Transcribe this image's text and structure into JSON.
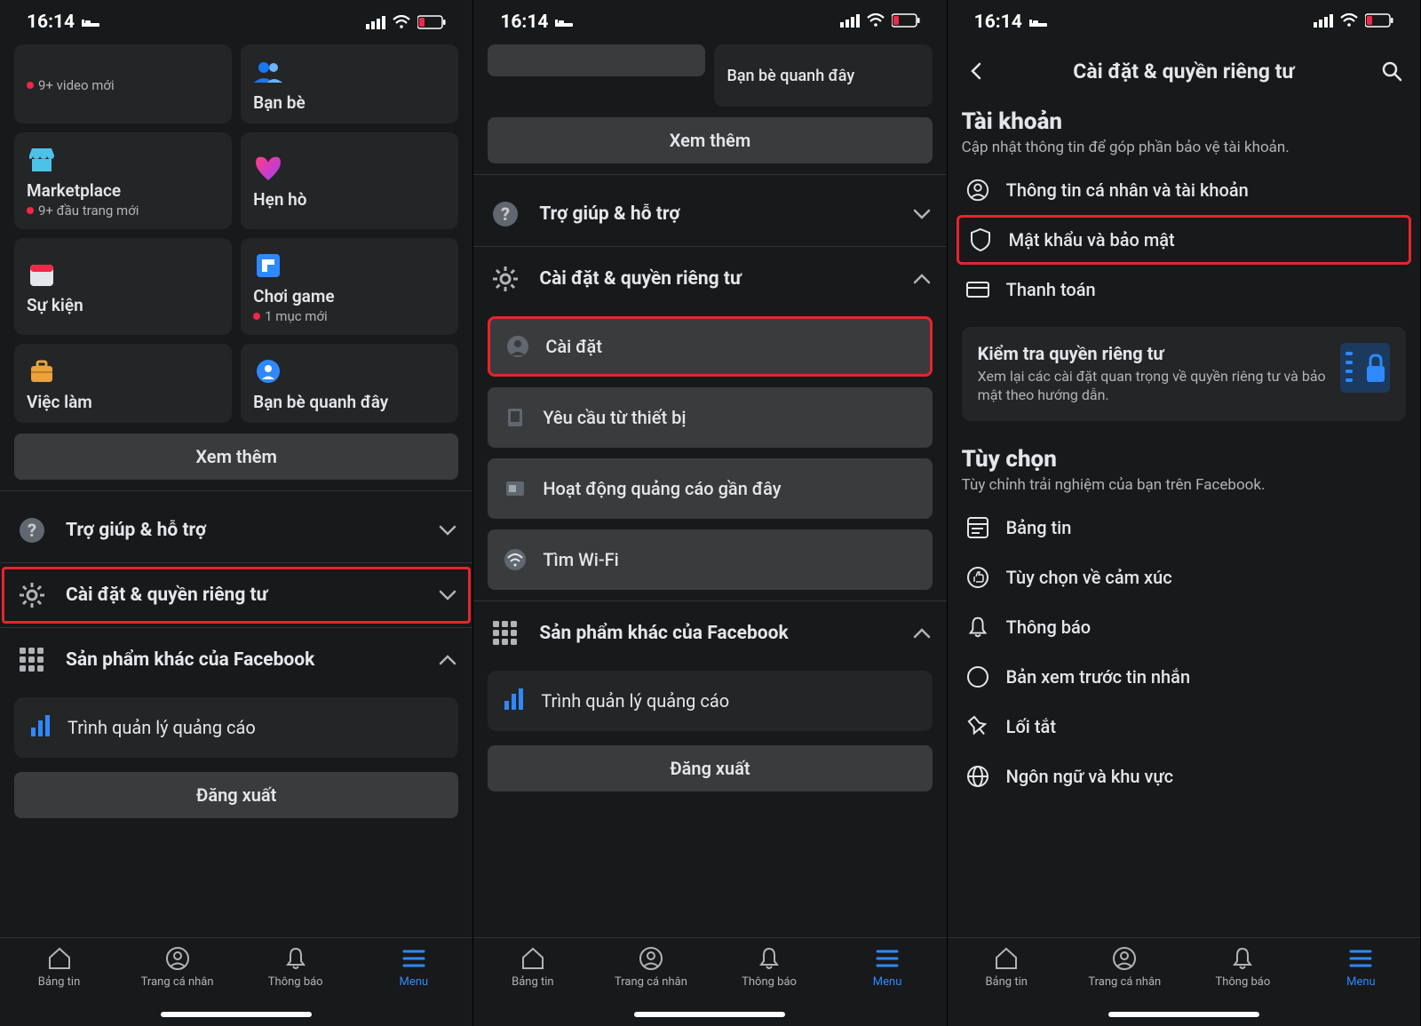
{
  "statusbar": {
    "time": "16:14"
  },
  "screen1": {
    "tiles": {
      "video_sub": "9+ video mới",
      "friends": "Bạn bè",
      "marketplace": "Marketplace",
      "marketplace_sub": "9+ đầu trang mới",
      "dating": "Hẹn hò",
      "events": "Sự kiện",
      "gaming": "Chơi game",
      "gaming_sub": "1 mục mới",
      "jobs": "Việc làm",
      "nearby": "Bạn bè quanh đây"
    },
    "see_more": "Xem thêm",
    "help": "Trợ giúp & hỗ trợ",
    "settings": "Cài đặt & quyền riêng tư",
    "other_products": "Sản phẩm khác của Facebook",
    "ads_manager": "Trình quản lý quảng cáo",
    "logout": "Đăng xuất"
  },
  "screen2": {
    "nearby": "Bạn bè quanh đây",
    "see_more": "Xem thêm",
    "help": "Trợ giúp & hỗ trợ",
    "settings": "Cài đặt & quyền riêng tư",
    "sub": {
      "settings": "Cài đặt",
      "device_req": "Yêu cầu từ thiết bị",
      "recent_ads": "Hoạt động quảng cáo gần đây",
      "find_wifi": "Tìm Wi-Fi"
    },
    "other_products": "Sản phẩm khác của Facebook",
    "ads_manager": "Trình quản lý quảng cáo",
    "logout": "Đăng xuất"
  },
  "screen3": {
    "header": "Cài đặt & quyền riêng tư",
    "account": {
      "title": "Tài khoản",
      "desc": "Cập nhật thông tin để góp phần bảo vệ tài khoản.",
      "personal": "Thông tin cá nhân và tài khoản",
      "password": "Mật khẩu và bảo mật",
      "payment": "Thanh toán"
    },
    "privacy_card": {
      "title": "Kiểm tra quyền riêng tư",
      "desc": "Xem lại các cài đặt quan trọng về quyền riêng tư và bảo mật theo hướng dẫn."
    },
    "prefs": {
      "title": "Tùy chọn",
      "desc": "Tùy chỉnh trải nghiệm của bạn trên Facebook.",
      "newsfeed": "Bảng tin",
      "reaction": "Tùy chọn về cảm xúc",
      "notif": "Thông báo",
      "dark": "Bản xem trước tin nhắn",
      "shortcut": "Lối tắt",
      "lang": "Ngôn ngữ và khu vực"
    }
  },
  "nav": {
    "feed": "Bảng tin",
    "profile": "Trang cá nhân",
    "notif": "Thông báo",
    "menu": "Menu"
  }
}
